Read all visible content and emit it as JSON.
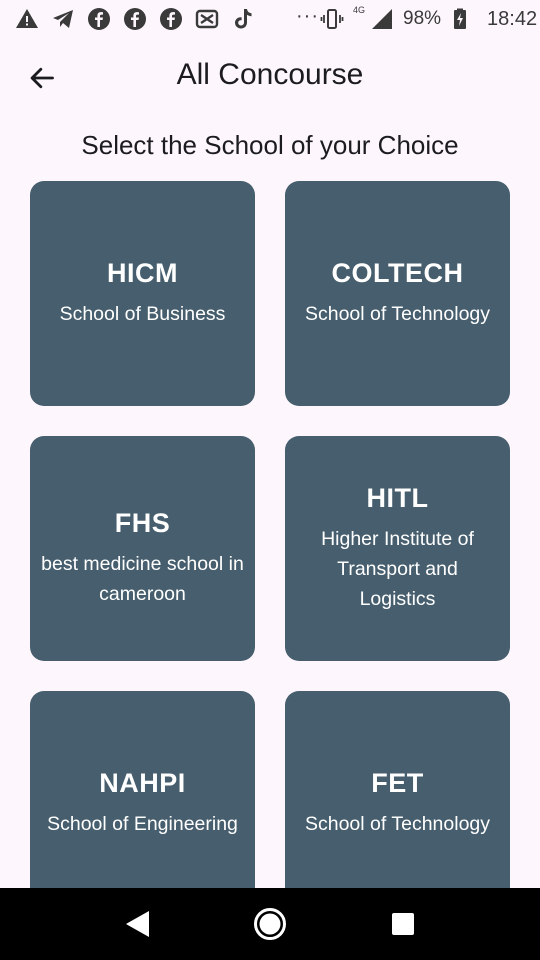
{
  "status_bar": {
    "icons": [
      "alert-triangle-icon",
      "telegram-icon",
      "facebook-icon",
      "facebook-icon",
      "facebook-icon",
      "capcut-icon",
      "tiktok-icon"
    ],
    "more": "···",
    "network_label": "4G",
    "battery": "98%",
    "time": "18:42"
  },
  "app_bar": {
    "back_icon": "arrow-left-icon",
    "title": "All Concourse"
  },
  "subtitle": "Select the School of your Choice",
  "colors": {
    "card_background": "#465e6d",
    "page_background": "#fdf7fd"
  },
  "schools": [
    {
      "name": "HICM",
      "description": "School of Business"
    },
    {
      "name": "COLTECH",
      "description": "School of Technology"
    },
    {
      "name": "FHS",
      "description": "best medicine school in cameroon"
    },
    {
      "name": "HITL",
      "description": "Higher Institute of Transport and Logistics"
    },
    {
      "name": "NAHPI",
      "description": "School of Engineering"
    },
    {
      "name": "FET",
      "description": "School of Technology"
    }
  ],
  "nav_bar": {
    "back": "triangle-back-icon",
    "home": "circle-home-icon",
    "recents": "square-recents-icon"
  }
}
